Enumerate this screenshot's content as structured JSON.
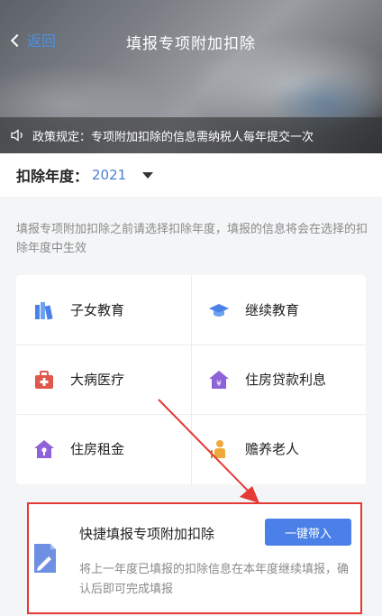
{
  "header": {
    "back_label": "返回",
    "title": "填报专项附加扣除",
    "notice": "政策规定：专项附加扣除的信息需纳税人每年提交一次"
  },
  "year": {
    "label": "扣除年度：",
    "value": "2021"
  },
  "hint": "填报专项附加扣除之前请选择扣除年度，填报的信息将会在选择的扣除年度中生效",
  "items": [
    {
      "label": "子女教育",
      "icon": "children-education-icon"
    },
    {
      "label": "继续教育",
      "icon": "graduation-cap-icon"
    },
    {
      "label": "大病医疗",
      "icon": "medical-kit-icon"
    },
    {
      "label": "住房贷款利息",
      "icon": "house-yen-icon"
    },
    {
      "label": "住房租金",
      "icon": "house-key-icon"
    },
    {
      "label": "赡养老人",
      "icon": "elderly-person-icon"
    }
  ],
  "quick": {
    "title": "快捷填报专项附加扣除",
    "button": "一键带入",
    "desc": "将上一年度已填报的扣除信息在本年度继续填报，确认后即可完成填报"
  },
  "colors": {
    "accent": "#4a80e8",
    "highlight": "#e53935"
  }
}
